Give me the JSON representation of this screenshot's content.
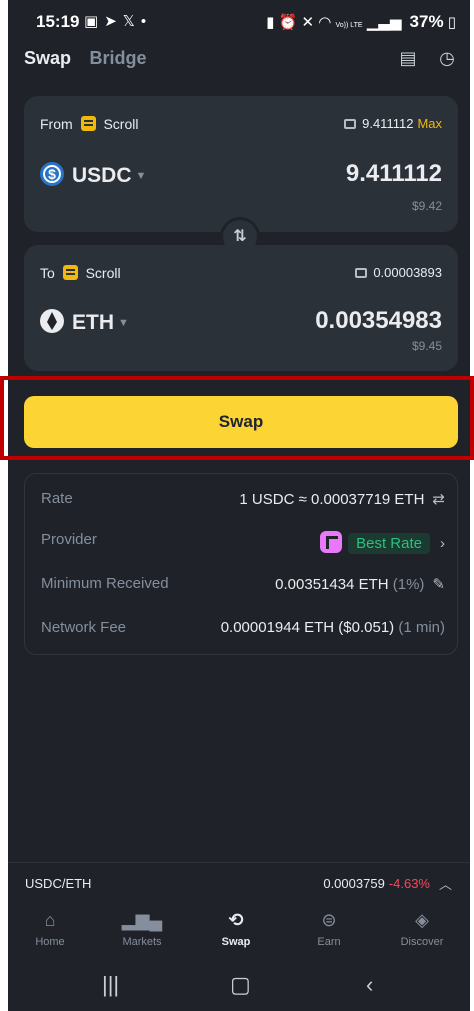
{
  "status_bar": {
    "time": "15:19",
    "left_icons": [
      "image-icon",
      "telegram-icon",
      "x-icon",
      "dot-icon"
    ],
    "right_icons": [
      "battery-saver-icon",
      "alarm-icon",
      "mute-icon",
      "wifi-icon",
      "volte-icon",
      "signal-icon"
    ],
    "volte_label": "Vo)) LTE",
    "battery": "37%"
  },
  "header": {
    "tabs": [
      {
        "label": "Swap",
        "active": true
      },
      {
        "label": "Bridge",
        "active": false
      }
    ],
    "icons": [
      "order-history-icon",
      "history-clock-icon"
    ]
  },
  "from_card": {
    "direction_label": "From",
    "chain": "Scroll",
    "balance": "9.411112",
    "max_label": "Max",
    "token": "USDC",
    "amount": "9.411112",
    "fiat_value": "$9.42"
  },
  "to_card": {
    "direction_label": "To",
    "chain": "Scroll",
    "balance": "0.00003893",
    "token": "ETH",
    "amount": "0.00354983",
    "fiat_value": "$9.45"
  },
  "switch_icon": "swap-direction-icon",
  "swap_button": {
    "label": "Swap"
  },
  "details": {
    "rate": {
      "label": "Rate",
      "value": "1 USDC ≈ 0.00037719 ETH"
    },
    "provider": {
      "label": "Provider",
      "badge": "Best Rate"
    },
    "minimum_received": {
      "label": "Minimum Received",
      "value": "0.00351434 ETH",
      "slippage": "(1%)"
    },
    "network_fee": {
      "label": "Network Fee",
      "value": "0.00001944 ETH ($0.051)",
      "time": "(1 min)"
    }
  },
  "ticker": {
    "pair": "USDC/ETH",
    "price": "0.0003759",
    "change": "-4.63%"
  },
  "bottom_nav": [
    {
      "label": "Home",
      "icon": "home-icon",
      "active": false
    },
    {
      "label": "Markets",
      "icon": "markets-icon",
      "active": false
    },
    {
      "label": "Swap",
      "icon": "swap-icon",
      "active": true
    },
    {
      "label": "Earn",
      "icon": "earn-icon",
      "active": false
    },
    {
      "label": "Discover",
      "icon": "discover-icon",
      "active": false
    }
  ],
  "colors": {
    "background": "#1f2329",
    "card": "#2b3139",
    "accent": "#fcd535",
    "positive": "#2ebd85",
    "negative": "#f6465d",
    "highlight_box": "#c00000"
  }
}
